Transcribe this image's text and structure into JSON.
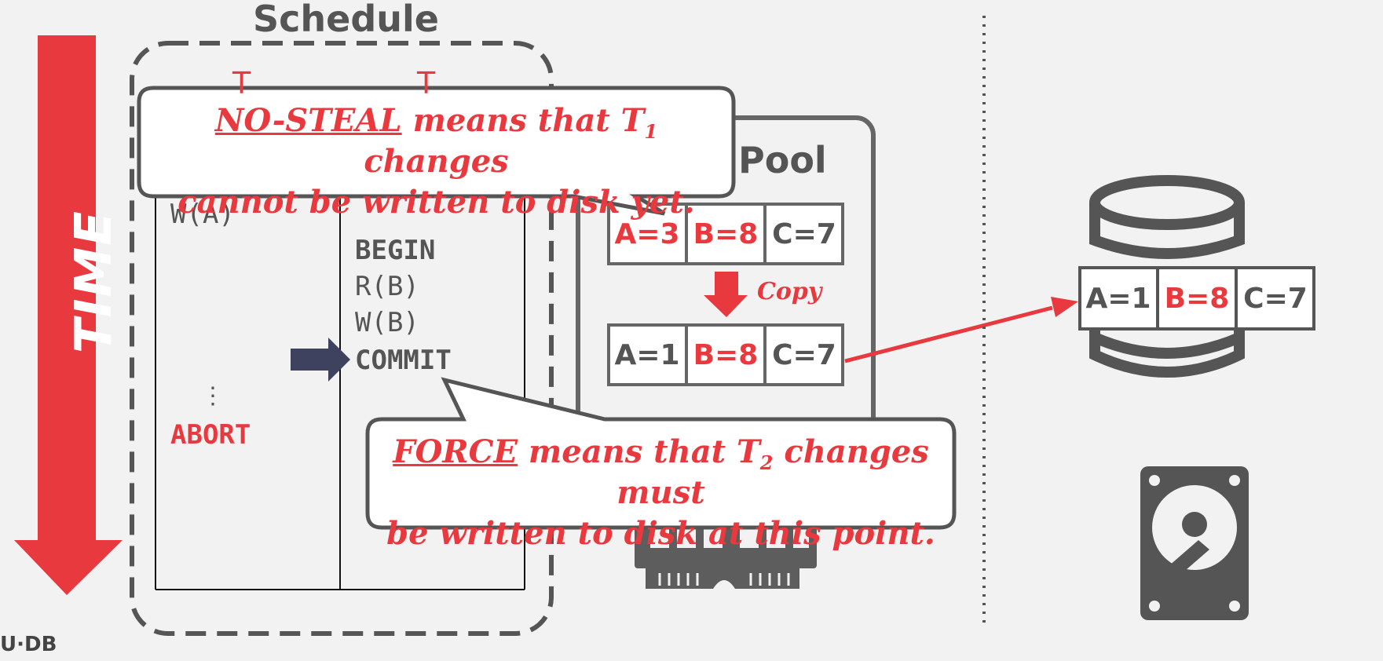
{
  "time_label": "TIME",
  "schedule": {
    "title": "Schedule",
    "t1": {
      "header": "T",
      "ops": [
        "W(A)"
      ],
      "ellipsis": "⋮",
      "abort": "ABORT"
    },
    "t2": {
      "header": "T",
      "begin": "BEGIN",
      "ops": [
        "R(B)",
        "W(B)"
      ],
      "commit": "COMMIT"
    }
  },
  "buffer_pool": {
    "title": "Pool",
    "top_cells": [
      {
        "text": "A=3",
        "color": "#e8393f"
      },
      {
        "text": "B=8",
        "color": "#e8393f"
      },
      {
        "text": "C=7",
        "color": "#555555"
      }
    ],
    "copy_label": "Copy",
    "bottom_cells": [
      {
        "text": "A=1",
        "color": "#555555"
      },
      {
        "text": "B=8",
        "color": "#e8393f"
      },
      {
        "text": "C=7",
        "color": "#555555"
      }
    ]
  },
  "disk": {
    "cells": [
      {
        "text": "A=1",
        "color": "#555555"
      },
      {
        "text": "B=8",
        "color": "#e8393f"
      },
      {
        "text": "C=7",
        "color": "#555555"
      }
    ]
  },
  "callouts": {
    "no_steal": {
      "term": "NO-STEAL",
      "pre_sub": " means that T",
      "sub": "1",
      "post_sub": " changes",
      "line2": "cannot be written to disk yet."
    },
    "force": {
      "term": "FORCE",
      "pre_sub": " means that T",
      "sub": "2",
      "post_sub": " changes must",
      "line2": "be written to disk at this point."
    }
  },
  "footer": {
    "logo": "U·DB"
  },
  "colors": {
    "accent": "#e8393f",
    "gray": "#555555",
    "navy": "#3f425e",
    "background": "#f2f2f2"
  }
}
